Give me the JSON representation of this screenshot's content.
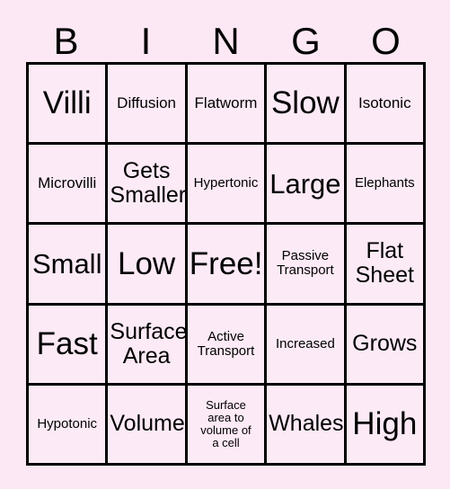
{
  "card": {
    "background_color": "#fbe8f4",
    "cell_color": "#fceaf6",
    "line_color": "#000000",
    "text_color": "#000000"
  },
  "header": {
    "letters": [
      "B",
      "I",
      "N",
      "G",
      "O"
    ]
  },
  "grid": {
    "columns": 5,
    "rows": 5,
    "cells": [
      {
        "text": "Villi",
        "size": "fs-xl"
      },
      {
        "text": "Diffusion",
        "size": "fs-sm"
      },
      {
        "text": "Flatworm",
        "size": "fs-sm"
      },
      {
        "text": "Slow",
        "size": "fs-xl"
      },
      {
        "text": "Isotonic",
        "size": "fs-sm"
      },
      {
        "text": "Microvilli",
        "size": "fs-sm"
      },
      {
        "text": "Gets\nSmaller",
        "size": "fs-md"
      },
      {
        "text": "Hypertonic",
        "size": "fs-xs"
      },
      {
        "text": "Large",
        "size": "fs-lg"
      },
      {
        "text": "Elephants",
        "size": "fs-xs"
      },
      {
        "text": "Small",
        "size": "fs-lg"
      },
      {
        "text": "Low",
        "size": "fs-xl"
      },
      {
        "text": "Free!",
        "size": "fs-xl"
      },
      {
        "text": "Passive\nTransport",
        "size": "fs-xs"
      },
      {
        "text": "Flat\nSheet",
        "size": "fs-md"
      },
      {
        "text": "Fast",
        "size": "fs-xl"
      },
      {
        "text": "Surface\nArea",
        "size": "fs-md"
      },
      {
        "text": "Active\nTransport",
        "size": "fs-xs"
      },
      {
        "text": "Increased",
        "size": "fs-xs"
      },
      {
        "text": "Grows",
        "size": "fs-md"
      },
      {
        "text": "Hypotonic",
        "size": "fs-xs"
      },
      {
        "text": "Volume",
        "size": "fs-md"
      },
      {
        "text": "Surface\narea to\nvolume of\na cell",
        "size": "fs-xxs"
      },
      {
        "text": "Whales",
        "size": "fs-md"
      },
      {
        "text": "High",
        "size": "fs-xl"
      }
    ]
  }
}
